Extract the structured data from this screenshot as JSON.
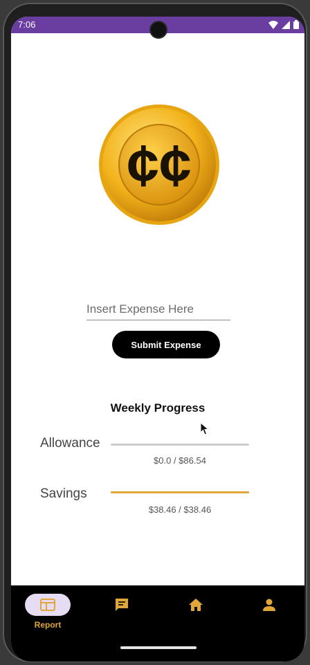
{
  "status_bar": {
    "time": "7:06"
  },
  "logo": {
    "text": "¢¢",
    "description": "cc-coin-logo"
  },
  "expense_form": {
    "input_value": "",
    "placeholder": "Insert Expense Here",
    "submit_label": "Submit Expense"
  },
  "progress": {
    "title": "Weekly Progress",
    "items": [
      {
        "label": "Allowance",
        "current": 0.0,
        "total": 86.54,
        "fraction": 0.0,
        "value_text": "$0.0 / $86.54",
        "color": "#cccccc"
      },
      {
        "label": "Savings",
        "current": 38.46,
        "total": 38.46,
        "fraction": 1.0,
        "value_text": "$38.46 / $38.46",
        "color": "#e0a63a"
      }
    ]
  },
  "nav": {
    "active": "Report",
    "accent": "#e0a63a",
    "items": [
      {
        "label": "Report",
        "icon": "report-icon"
      },
      {
        "label": "",
        "icon": "chat-icon"
      },
      {
        "label": "",
        "icon": "home-icon"
      },
      {
        "label": "",
        "icon": "person-icon"
      }
    ]
  },
  "colors": {
    "status_bar": "#6a3ea1",
    "nav_bar": "#000000",
    "button": "#000000",
    "active_pill": "#e6dcf3"
  }
}
